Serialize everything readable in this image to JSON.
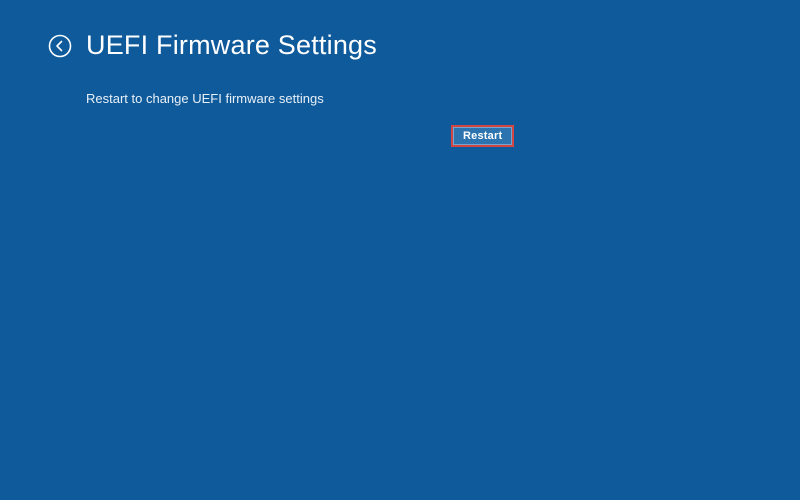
{
  "header": {
    "title": "UEFI Firmware Settings"
  },
  "main": {
    "description": "Restart to change UEFI firmware settings",
    "restart_label": "Restart"
  },
  "colors": {
    "background": "#0f5a9b",
    "button_bg": "#2b74b0",
    "highlight_border": "#d14545"
  }
}
